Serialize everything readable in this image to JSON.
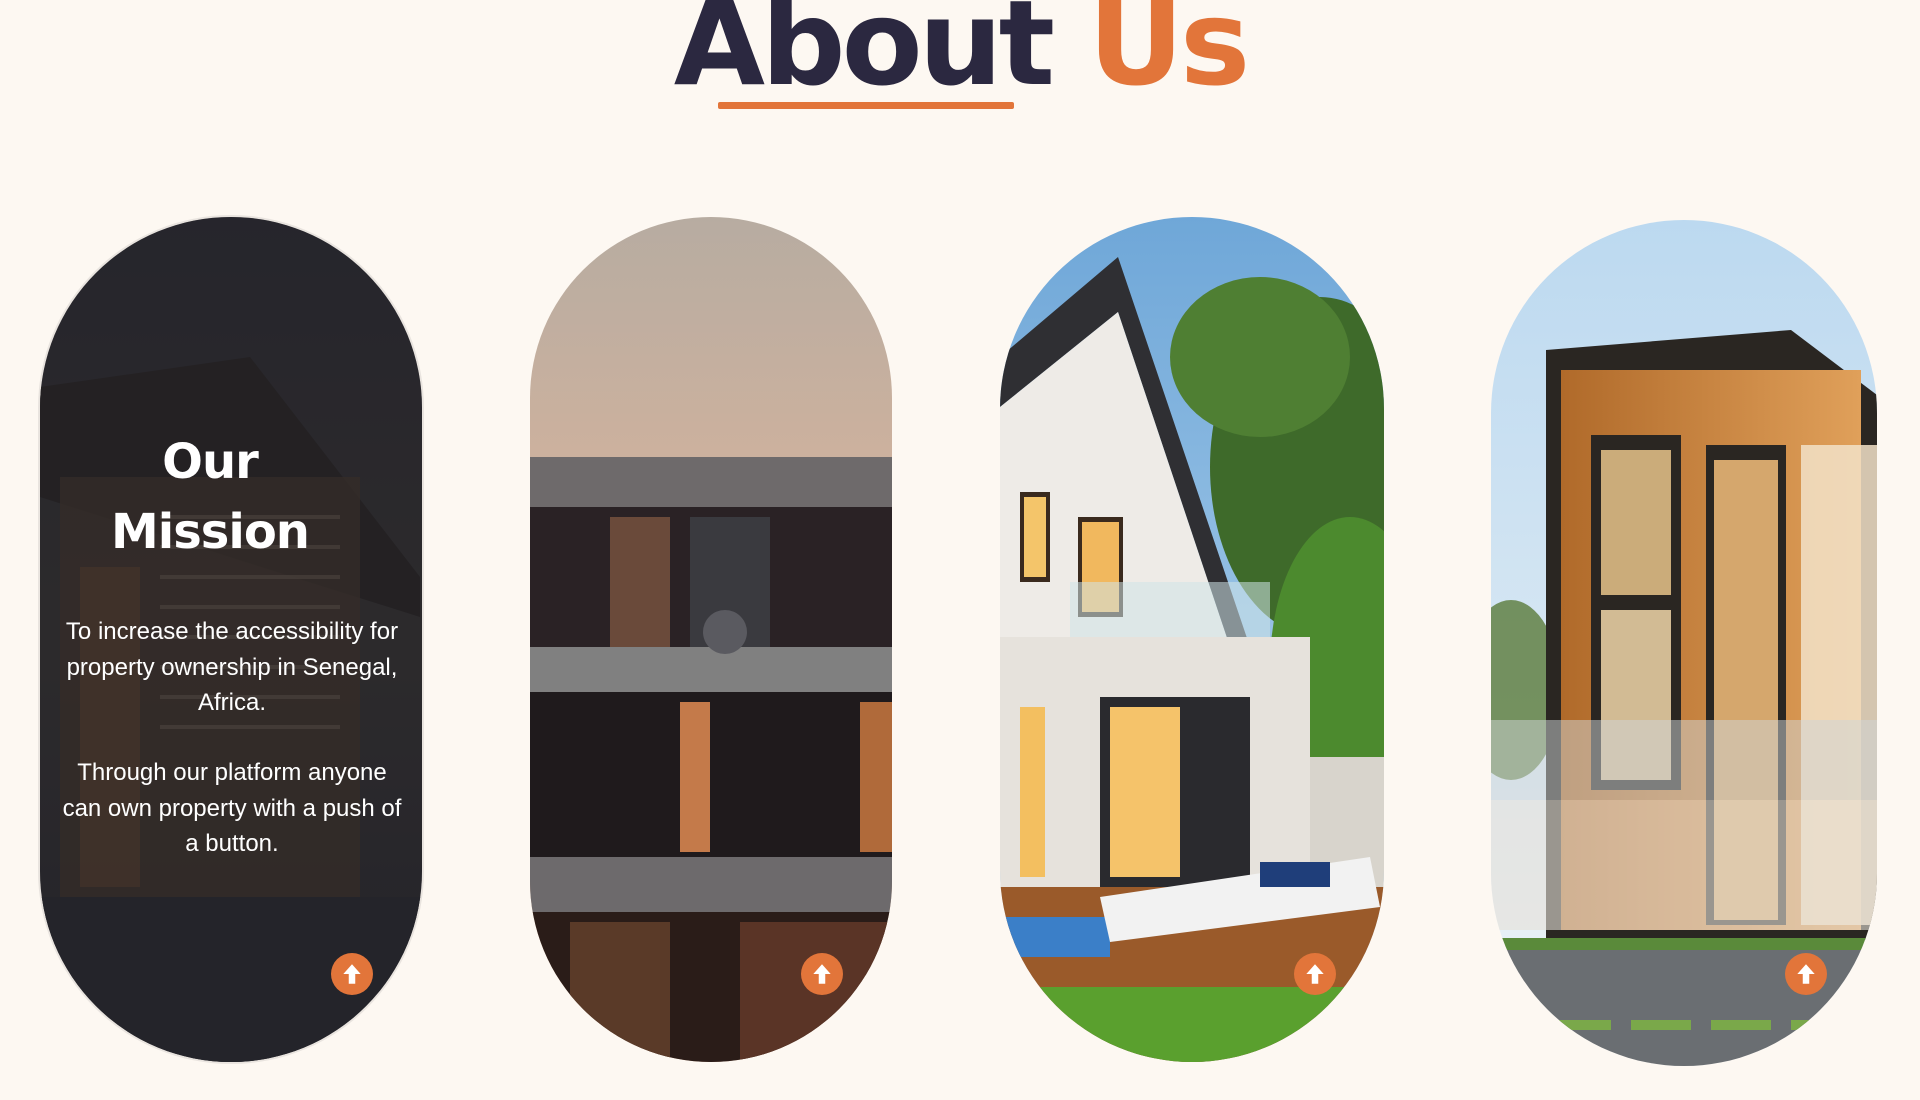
{
  "heading": {
    "word1": "About",
    "word2": "Us"
  },
  "colors": {
    "accent": "#e2753a",
    "dark": "#2b2840",
    "background": "#fdf8f2"
  },
  "cards": [
    {
      "title_line1": "Our",
      "title_line2": "Mission",
      "paragraph1": "To increase the accessibility for property ownership in Senegal, Africa.",
      "paragraph2": "Through our platform anyone can own property with a push of a button.",
      "button_icon": "arrow-up-icon"
    },
    {
      "button_icon": "arrow-up-icon"
    },
    {
      "button_icon": "arrow-up-icon"
    },
    {
      "button_icon": "arrow-up-icon"
    }
  ]
}
